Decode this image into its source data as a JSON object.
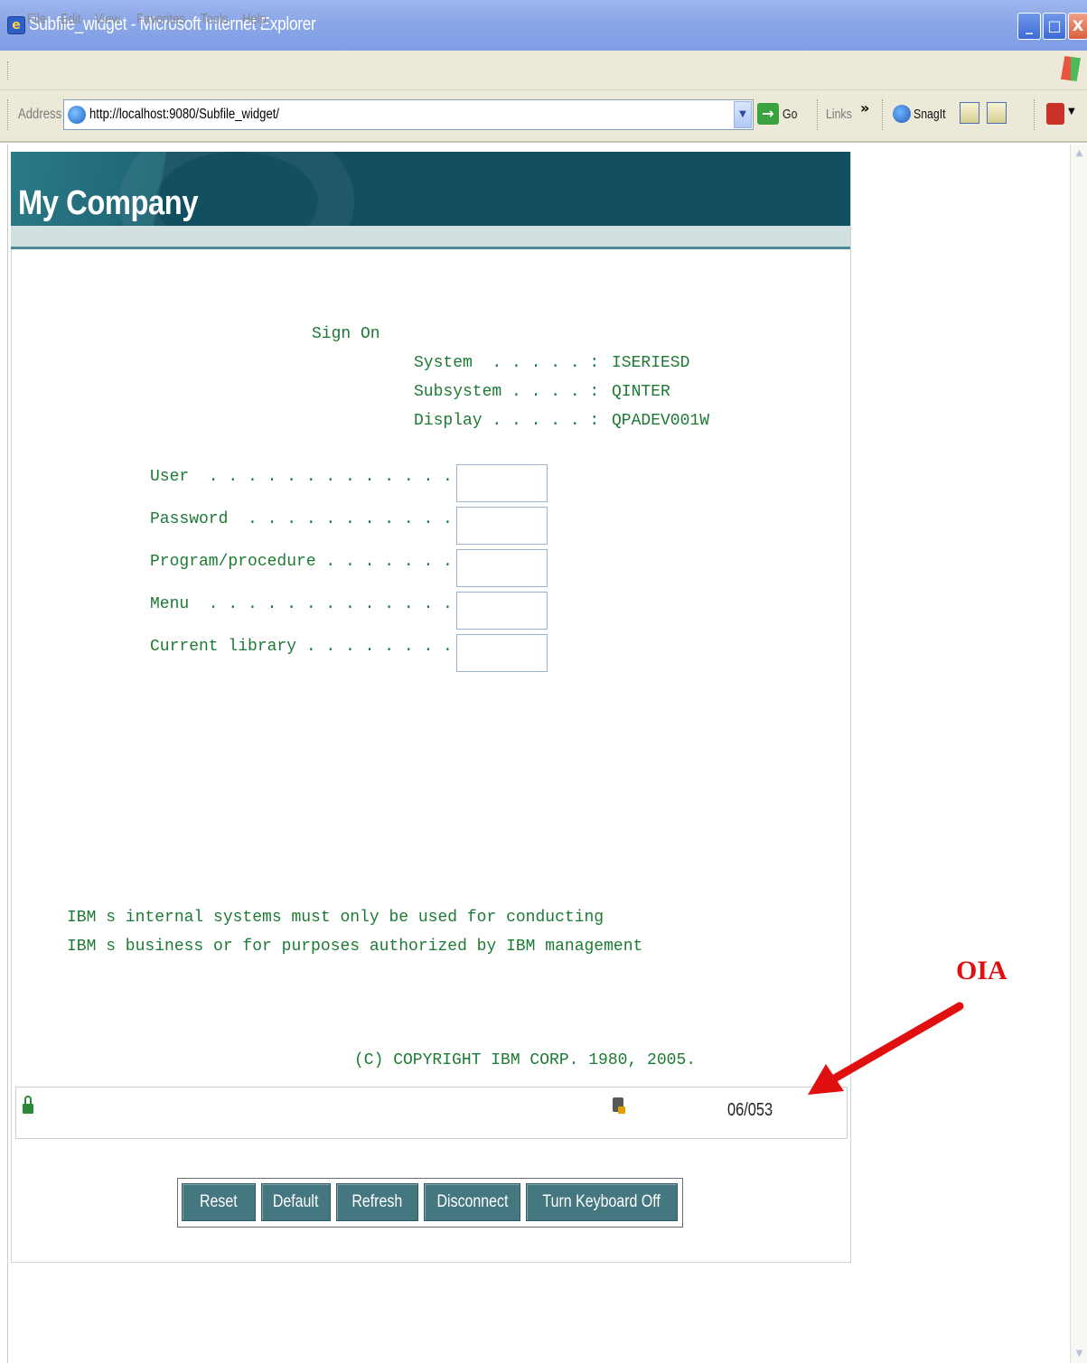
{
  "window": {
    "title": "Subfile_widget - Microsoft Internet Explorer",
    "min": "_",
    "max": "□",
    "close": "X"
  },
  "menu": [
    "File",
    "Edit",
    "View",
    "Favorites",
    "Tools",
    "Help"
  ],
  "address": {
    "label": "Address",
    "url": "http://localhost:9080/Subfile_widget/",
    "go": "Go",
    "links": "Links",
    "links_more": "»",
    "snagit": "SnagIt"
  },
  "banner": {
    "title": "My Company"
  },
  "screen": {
    "heading": "Sign On",
    "info": [
      {
        "label": "System  . . . . . :",
        "value": "ISERIESD"
      },
      {
        "label": "Subsystem . . . . :",
        "value": "QINTER"
      },
      {
        "label": "Display . . . . . :",
        "value": "QPADEV001W"
      }
    ],
    "fields": [
      {
        "label": "User  . . . . . . . . . . . . . .",
        "value": ""
      },
      {
        "label": "Password  . . . . . . . . . . . .",
        "value": ""
      },
      {
        "label": "Program/procedure . . . . . . . .",
        "value": ""
      },
      {
        "label": "Menu  . . . . . . . . . . . . . .",
        "value": ""
      },
      {
        "label": "Current library . . . . . . . . .",
        "value": ""
      }
    ],
    "notice_line1": "IBM s internal systems must only be used for conducting",
    "notice_line2": "IBM s business or for purposes authorized by IBM management",
    "copyright": "(C) COPYRIGHT IBM CORP. 1980, 2005."
  },
  "oia": {
    "cursor_position": "06/053"
  },
  "buttons": [
    "Reset",
    "Default",
    "Refresh",
    "Disconnect",
    "Turn Keyboard Off"
  ],
  "annotation": {
    "label": "OIA",
    "color": "#e01010"
  },
  "colors": {
    "banner": "#124f60",
    "screen_text": "#1d7a34",
    "button": "#44777f"
  },
  "icons": [
    "ie-page-icon",
    "go-arrow-icon",
    "snagit-icon",
    "lock-icon",
    "keyboard-icon",
    "pdf-icon"
  ]
}
